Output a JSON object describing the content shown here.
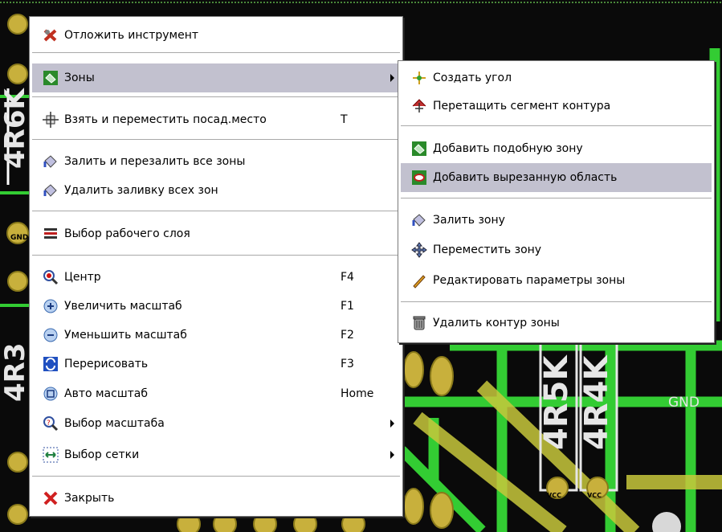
{
  "colors": {
    "pcb_background": "#0a0a0a",
    "track_green": "#33cc33",
    "track_yellow": "#c8c83c",
    "pad_yellow": "#d8c84c",
    "silk_white": "#e6e6e6",
    "menu_bg": "#ffffff",
    "menu_highlight": "#c2c1cf",
    "menu_separator": "#a9a9a9"
  },
  "board": {
    "net_gnd": "GND",
    "ref_r5": "4R5K",
    "ref_r4": "4R4K",
    "ref_r6": "4R6K",
    "ref_r3": "4R3",
    "pad_gnd": "GND",
    "pad_vcc_1": "VCC",
    "pad_vcc_2": "VCC"
  },
  "main_menu": {
    "items": [
      {
        "label": "Отложить инструмент",
        "shortcut": "",
        "icon": "cancel-tool-icon",
        "submenu": false
      },
      {
        "label": "Зоны",
        "shortcut": "",
        "icon": "zone-icon",
        "submenu": true
      },
      {
        "label": "Взять и переместить посад.место",
        "shortcut": "T",
        "icon": "move-footprint-icon",
        "submenu": false
      },
      {
        "label": "Залить и перезалить все зоны",
        "shortcut": "",
        "icon": "fill-zones-icon",
        "submenu": false
      },
      {
        "label": "Удалить заливку всех зон",
        "shortcut": "",
        "icon": "unfill-zones-icon",
        "submenu": false
      },
      {
        "label": "Выбор рабочего слоя",
        "shortcut": "",
        "icon": "layers-icon",
        "submenu": false
      },
      {
        "label": "Центр",
        "shortcut": "F4",
        "icon": "zoom-center-icon",
        "submenu": false
      },
      {
        "label": "Увеличить масштаб",
        "shortcut": "F1",
        "icon": "zoom-in-icon",
        "submenu": false
      },
      {
        "label": "Уменьшить масштаб",
        "shortcut": "F2",
        "icon": "zoom-out-icon",
        "submenu": false
      },
      {
        "label": "Перерисовать",
        "shortcut": "F3",
        "icon": "redraw-icon",
        "submenu": false
      },
      {
        "label": "Авто масштаб",
        "shortcut": "Home",
        "icon": "zoom-auto-icon",
        "submenu": false
      },
      {
        "label": "Выбор масштаба",
        "shortcut": "",
        "icon": "zoom-select-icon",
        "submenu": true
      },
      {
        "label": "Выбор сетки",
        "shortcut": "",
        "icon": "grid-select-icon",
        "submenu": true
      },
      {
        "label": "Закрыть",
        "shortcut": "",
        "icon": "close-icon",
        "submenu": false
      }
    ]
  },
  "zones_submenu": {
    "items": [
      {
        "label": "Создать угол",
        "icon": "add-corner-icon"
      },
      {
        "label": "Перетащить сегмент контура",
        "icon": "drag-segment-icon"
      },
      {
        "label": "Добавить подобную зону",
        "icon": "similar-zone-icon"
      },
      {
        "label": "Добавить вырезанную область",
        "icon": "cutout-area-icon"
      },
      {
        "label": "Залить зону",
        "icon": "fill-zone-icon"
      },
      {
        "label": "Переместить зону",
        "icon": "move-zone-icon"
      },
      {
        "label": "Редактировать параметры зоны",
        "icon": "edit-zone-icon"
      },
      {
        "label": "Удалить контур зоны",
        "icon": "delete-zone-icon"
      }
    ]
  }
}
